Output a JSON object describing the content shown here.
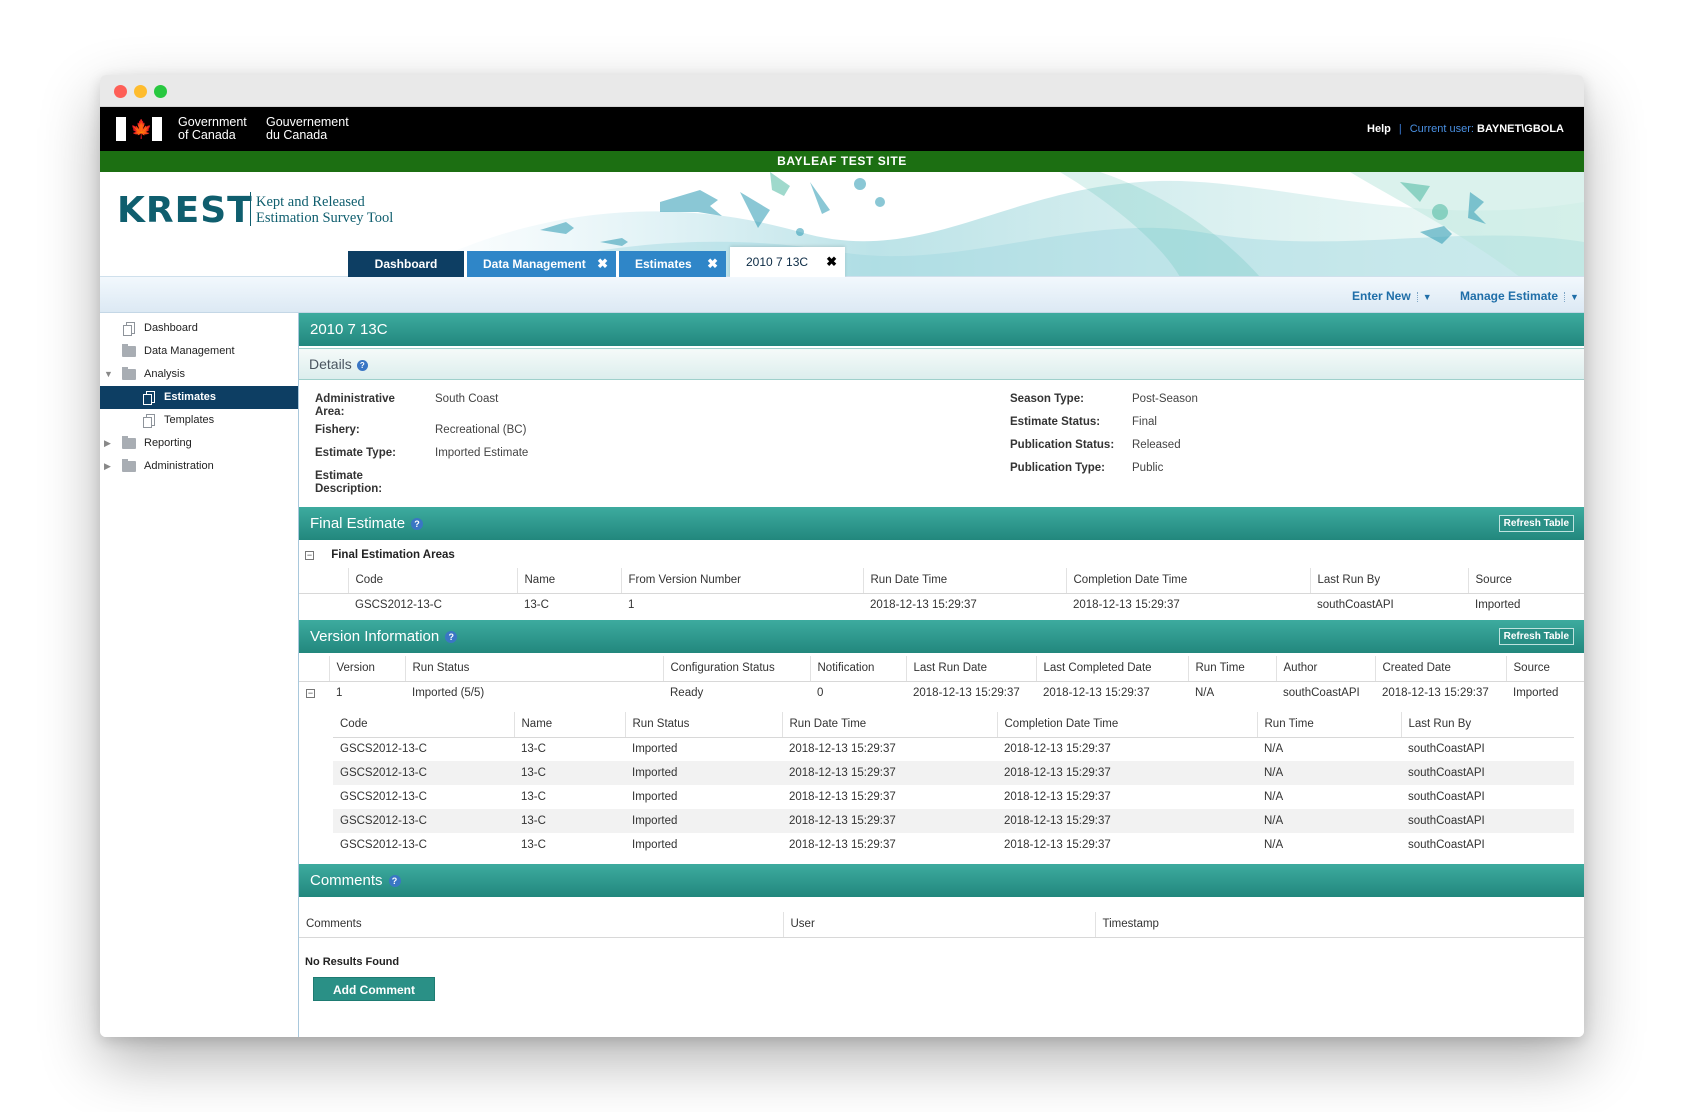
{
  "window_controls": {
    "close": "close",
    "minimize": "minimize",
    "zoom": "zoom"
  },
  "gov": {
    "name_en_1": "Government",
    "name_en_2": "of Canada",
    "name_fr_1": "Gouvernement",
    "name_fr_2": "du Canada",
    "help": "Help",
    "current_user_label": "Current user:",
    "current_user": "BAYNET\\GBOLA"
  },
  "site_name": "BAYLEAF TEST SITE",
  "app": {
    "logo": "KREST",
    "subtitle_1": "Kept and Released",
    "subtitle_2": "Estimation Survey Tool"
  },
  "tabs": [
    {
      "label": "Dashboard"
    },
    {
      "label": "Data Management"
    },
    {
      "label": "Estimates"
    },
    {
      "label": "2010 7 13C"
    }
  ],
  "toolbar": {
    "enter_new": "Enter New",
    "manage_estimate": "Manage Estimate"
  },
  "sidebar": {
    "items": [
      {
        "label": "Dashboard"
      },
      {
        "label": "Data Management"
      },
      {
        "label": "Analysis"
      },
      {
        "label": "Estimates"
      },
      {
        "label": "Templates"
      },
      {
        "label": "Reporting"
      },
      {
        "label": "Administration"
      }
    ]
  },
  "estimate": {
    "title": "2010 7 13C",
    "details_label": "Details",
    "fields_left": [
      {
        "key": "Administrative Area:",
        "value": "South Coast"
      },
      {
        "key": "Fishery:",
        "value": "Recreational (BC)"
      },
      {
        "key": "Estimate Type:",
        "value": "Imported Estimate"
      },
      {
        "key": "Estimate Description:",
        "value": ""
      }
    ],
    "fields_right": [
      {
        "key": "Season Type:",
        "value": "Post-Season"
      },
      {
        "key": "Estimate Status:",
        "value": "Final"
      },
      {
        "key": "Publication Status:",
        "value": "Released"
      },
      {
        "key": "Publication Type:",
        "value": "Public"
      }
    ]
  },
  "final_estimate": {
    "title": "Final Estimate",
    "refresh": "Refresh Table",
    "group_label": "Final Estimation Areas",
    "columns": [
      "Code",
      "Name",
      "From Version Number",
      "Run Date Time",
      "Completion Date Time",
      "Last Run By",
      "Source"
    ],
    "rows": [
      [
        "GSCS2012-13-C",
        "13-C",
        "1",
        "2018-12-13 15:29:37",
        "2018-12-13 15:29:37",
        "southCoastAPI",
        "Imported"
      ]
    ]
  },
  "version_info": {
    "title": "Version Information",
    "refresh": "Refresh Table",
    "columns": [
      "Version",
      "Run Status",
      "Configuration Status",
      "Notification",
      "Last Run Date",
      "Last Completed Date",
      "Run Time",
      "Author",
      "Created Date",
      "Source"
    ],
    "row": [
      "1",
      "Imported (5/5)",
      "Ready",
      "0",
      "2018-12-13 15:29:37",
      "2018-12-13 15:29:37",
      "N/A",
      "southCoastAPI",
      "2018-12-13 15:29:37",
      "Imported"
    ],
    "sub_columns": [
      "Code",
      "Name",
      "Run Status",
      "Run Date Time",
      "Completion Date Time",
      "Run Time",
      "Last Run By"
    ],
    "sub_rows": [
      [
        "GSCS2012-13-C",
        "13-C",
        "Imported",
        "2018-12-13 15:29:37",
        "2018-12-13 15:29:37",
        "N/A",
        "southCoastAPI"
      ],
      [
        "GSCS2012-13-C",
        "13-C",
        "Imported",
        "2018-12-13 15:29:37",
        "2018-12-13 15:29:37",
        "N/A",
        "southCoastAPI"
      ],
      [
        "GSCS2012-13-C",
        "13-C",
        "Imported",
        "2018-12-13 15:29:37",
        "2018-12-13 15:29:37",
        "N/A",
        "southCoastAPI"
      ],
      [
        "GSCS2012-13-C",
        "13-C",
        "Imported",
        "2018-12-13 15:29:37",
        "2018-12-13 15:29:37",
        "N/A",
        "southCoastAPI"
      ],
      [
        "GSCS2012-13-C",
        "13-C",
        "Imported",
        "2018-12-13 15:29:37",
        "2018-12-13 15:29:37",
        "N/A",
        "southCoastAPI"
      ]
    ]
  },
  "comments": {
    "title": "Comments",
    "columns": [
      "Comments",
      "User",
      "Timestamp"
    ],
    "empty": "No Results Found",
    "add_button": "Add Comment"
  },
  "colors": {
    "gov_bar": "#000000",
    "site_bar": "#1c6f12",
    "navy": "#0d3e63",
    "tab_blue": "#2f86c8",
    "teal": "#2a9086",
    "logo": "#0f5e6e"
  }
}
